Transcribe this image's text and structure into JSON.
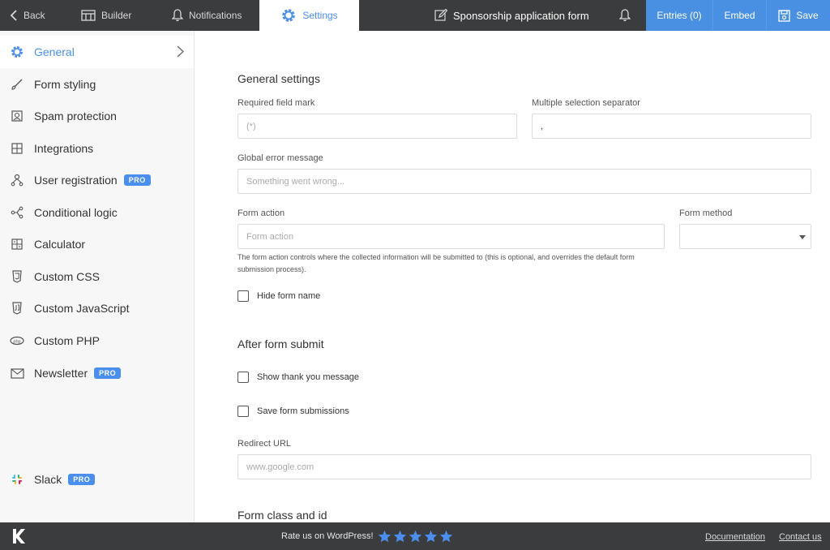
{
  "topbar": {
    "back": "Back",
    "builder": "Builder",
    "notifications": "Notifications",
    "settings": "Settings",
    "form_name": "Sponsorship application form",
    "entries": "Entries (0)",
    "embed": "Embed",
    "save": "Save"
  },
  "sidebar": {
    "items": [
      {
        "label": "General",
        "icon": "gear-icon",
        "active": true
      },
      {
        "label": "Form styling",
        "icon": "brush-icon"
      },
      {
        "label": "Spam protection",
        "icon": "spam-shield-icon"
      },
      {
        "label": "Integrations",
        "icon": "puzzle-icon"
      },
      {
        "label": "User registration",
        "icon": "user-registration-icon",
        "badge": "PRO"
      },
      {
        "label": "Conditional logic",
        "icon": "branch-icon"
      },
      {
        "label": "Calculator",
        "icon": "calculator-icon"
      },
      {
        "label": "Custom CSS",
        "icon": "css-icon"
      },
      {
        "label": "Custom JavaScript",
        "icon": "js-icon"
      },
      {
        "label": "Custom PHP",
        "icon": "php-icon"
      },
      {
        "label": "Newsletter",
        "icon": "envelope-icon",
        "badge": "PRO"
      },
      {
        "label": "Slack",
        "icon": "slack-icon",
        "badge": "PRO"
      }
    ]
  },
  "general_settings": {
    "title": "General settings",
    "required_mark_label": "Required field mark",
    "required_mark_placeholder": "(*)",
    "separator_label": "Multiple selection separator",
    "separator_value": ",",
    "global_error_label": "Global error message",
    "global_error_placeholder": "Something went wrong...",
    "form_action_label": "Form action",
    "form_action_placeholder": "Form action",
    "form_method_label": "Form method",
    "form_method_value": "",
    "form_action_help": "The form action controls where the collected information will be submitted to (this is optional, and overrides the default form submission process).",
    "hide_form_name": "Hide form name"
  },
  "after_submit": {
    "title": "After form submit",
    "show_thank_you": "Show thank you message",
    "save_submissions": "Save form submissions",
    "redirect_label": "Redirect URL",
    "redirect_placeholder": "www.google.com"
  },
  "form_class": {
    "title": "Form class and id"
  },
  "footer": {
    "rate": "Rate us on WordPress!",
    "stars": 5,
    "documentation": "Documentation",
    "contact": "Contact us"
  },
  "colors": {
    "accent": "#4a8ff0",
    "topbar_bg": "#3b3c3e",
    "button_bg": "#4a90e2"
  }
}
